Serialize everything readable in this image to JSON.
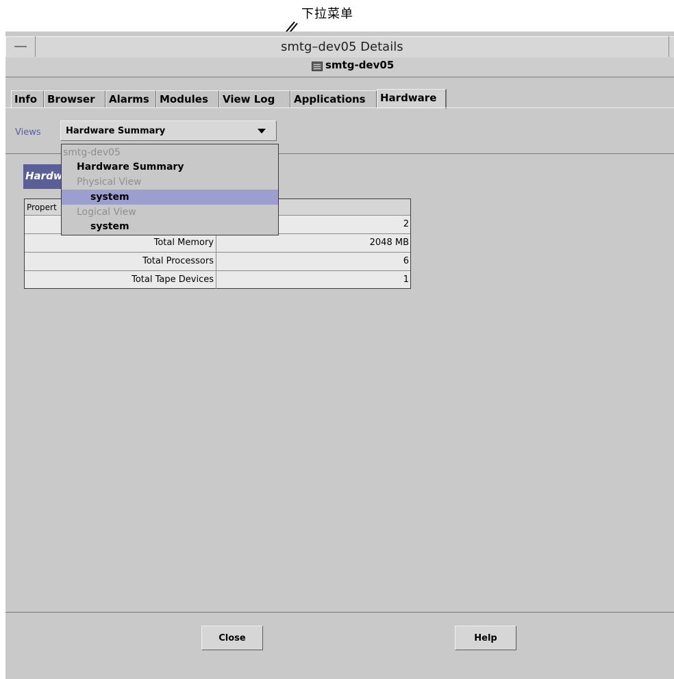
{
  "annotation": {
    "callout_label": "下拉菜单"
  },
  "window": {
    "title": "smtg–dev05 Details",
    "host": "smtg-dev05"
  },
  "tabs": [
    "Info",
    "Browser",
    "Alarms",
    "Modules",
    "View Log",
    "Applications",
    "Hardware"
  ],
  "active_tab": "Hardware",
  "views": {
    "label": "Views",
    "selected": "Hardware Summary",
    "options": [
      {
        "label": "smtg-dev05",
        "state": "disabled"
      },
      {
        "label": "Hardware Summary",
        "state": "enabled"
      },
      {
        "label": "Physical View",
        "state": "disabled"
      },
      {
        "label": "system",
        "state": "highlighted"
      },
      {
        "label": "Logical View",
        "state": "disabled"
      },
      {
        "label": "system",
        "state": "enabled"
      }
    ]
  },
  "panel": {
    "header": "Hardw"
  },
  "table": {
    "headers": [
      "Propert",
      ""
    ],
    "rows": [
      {
        "property": "",
        "value": "2"
      },
      {
        "property": "Total Memory",
        "value": "2048 MB"
      },
      {
        "property": "Total Processors",
        "value": "6"
      },
      {
        "property": "Total Tape Devices",
        "value": "1"
      }
    ]
  },
  "buttons": {
    "close": "Close",
    "help": "Help"
  }
}
